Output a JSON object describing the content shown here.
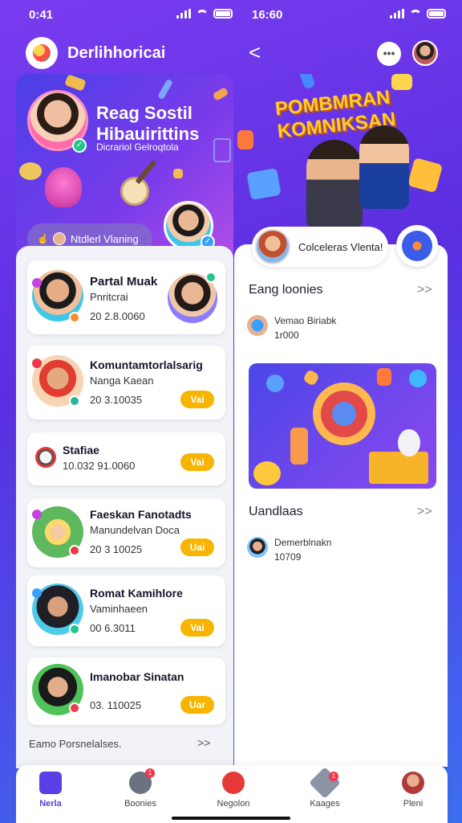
{
  "status_left": {
    "time": "0:41"
  },
  "status_right": {
    "time": "16:60"
  },
  "left": {
    "app_title": "Derlihhoricai",
    "hero": {
      "title": "Reag Sostil Hibauirittins",
      "subtitle": "Dicrariol Gelroqtola",
      "pill_label": "Ntdlerl Vlaning"
    },
    "cards": [
      {
        "name": "Partal Muak",
        "sub": "Pnritcrai",
        "num": "20 2.8.0060",
        "button": ""
      },
      {
        "name": "Komuntamtorlalsarig",
        "sub": "Nanga Kaean",
        "num": "20 3.10035",
        "button": "Vai"
      },
      {
        "name": "Stafiae",
        "sub": "",
        "num": "10.032 91.0060",
        "button": "Vai"
      },
      {
        "name": "Faeskan Fanotadts",
        "sub": "Manundelvan Doca",
        "num": "20 3 10025",
        "button": "Uai"
      },
      {
        "name": "Romat Kamihlore",
        "sub": "Vaminhaeen",
        "num": "00 6.3011",
        "button": "Vai"
      },
      {
        "name": "Imanobar Sinatan",
        "sub": "",
        "num": "03. 110025",
        "button": "Uar"
      }
    ],
    "more_link": "Eamo Porsnelalses.",
    "more_arrow": ">>"
  },
  "right": {
    "back": "<",
    "more": "•••",
    "banner_title": "POMBMRAN KOMNIKSAN",
    "profile_pill": "Colceleras Vlenta!",
    "section1": {
      "title": "Eang loonies",
      "arrow": ">>",
      "item_name": "Vemao Biriabk",
      "item_num": "1r000"
    },
    "section2": {
      "title": "Uandlaas",
      "arrow": ">>",
      "item_name": "Demerblnakn",
      "item_num": "10709"
    }
  },
  "bottom_nav": [
    {
      "label": "Nerla",
      "active": true
    },
    {
      "label": "Boonies",
      "active": false,
      "badge": "1"
    },
    {
      "label": "Negolon",
      "active": false
    },
    {
      "label": "Kaages",
      "active": false,
      "badge": "1"
    },
    {
      "label": "Pleni",
      "active": false
    }
  ],
  "colors": {
    "accent": "#5a3ee6",
    "button": "#f7b500",
    "background_top": "#7a3cf0",
    "background_bottom": "#3b6ef0"
  }
}
